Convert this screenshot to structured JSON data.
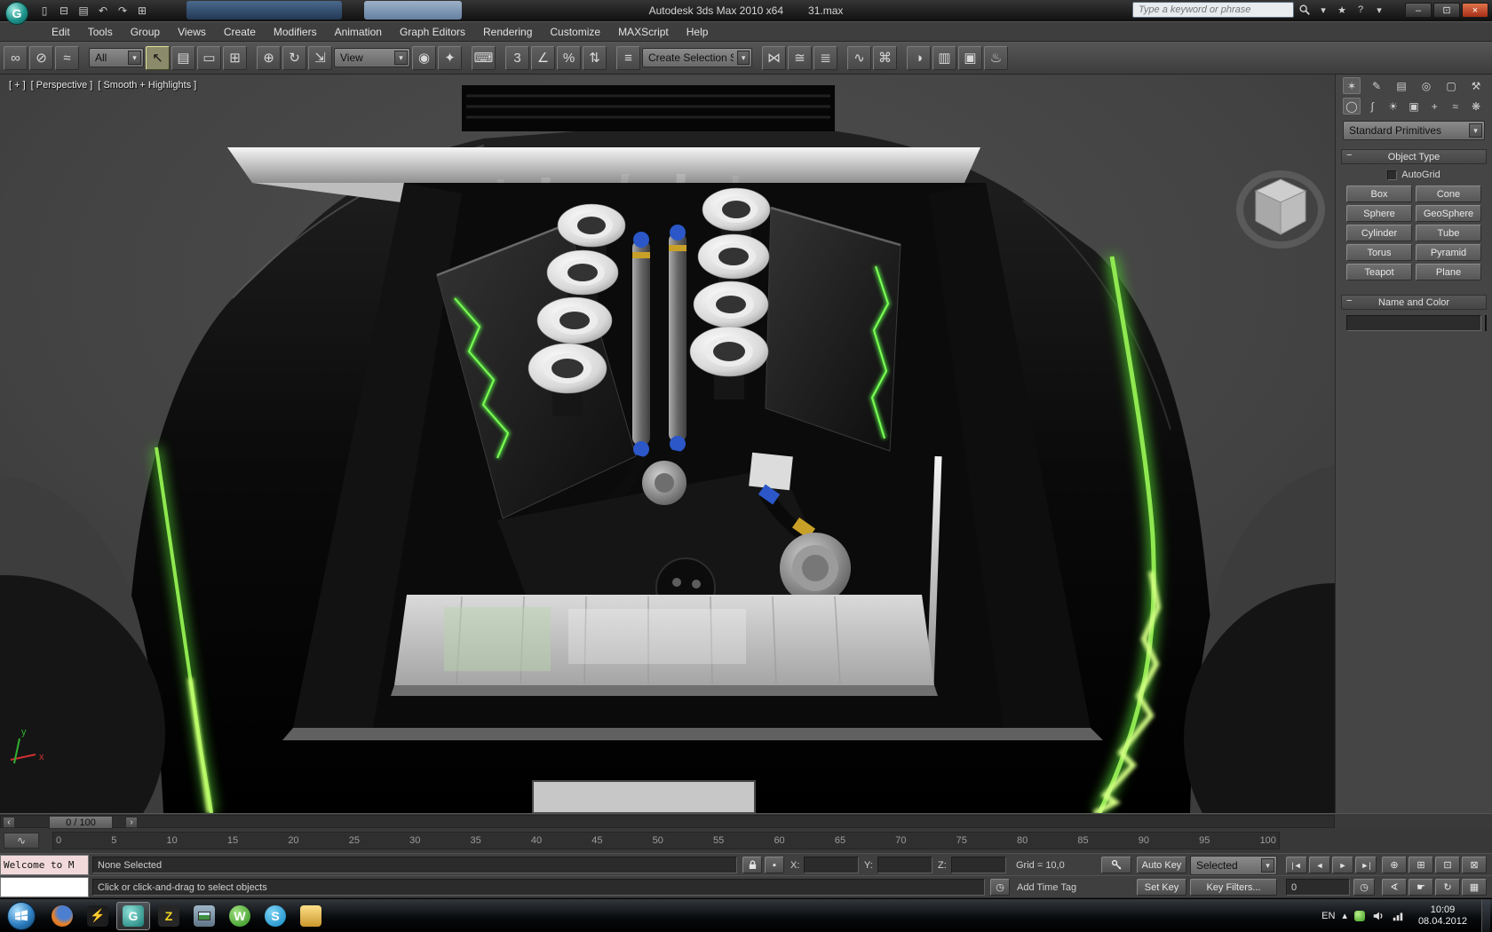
{
  "titlebar": {
    "app_title": "Autodesk 3ds Max 2010 x64",
    "document_name": "31.max",
    "search_placeholder": "Type a keyword or phrase"
  },
  "menubar": {
    "items": [
      "Edit",
      "Tools",
      "Group",
      "Views",
      "Create",
      "Modifiers",
      "Animation",
      "Graph Editors",
      "Rendering",
      "Customize",
      "MAXScript",
      "Help"
    ]
  },
  "toolbar": {
    "selection_filter_value": "All",
    "coordinate_system_value": "View",
    "named_selection_value": "Create Selection Se"
  },
  "viewport": {
    "label_general": "[ + ]",
    "label_pov": "[ Perspective ]",
    "label_shading": "[ Smooth + Highlights ]"
  },
  "command_panel": {
    "category_dropdown_value": "Standard Primitives",
    "object_type": {
      "title": "Object Type",
      "autogrid_label": "AutoGrid",
      "buttons": [
        "Box",
        "Cone",
        "Sphere",
        "GeoSphere",
        "Cylinder",
        "Tube",
        "Torus",
        "Pyramid",
        "Teapot",
        "Plane"
      ]
    },
    "name_color": {
      "title": "Name and Color",
      "name_value": "",
      "swatch_style": "background:#c01240"
    }
  },
  "timeline": {
    "slider_label": "0 / 100",
    "ticks": [
      "0",
      "5",
      "10",
      "15",
      "20",
      "25",
      "30",
      "35",
      "40",
      "45",
      "50",
      "55",
      "60",
      "65",
      "70",
      "75",
      "80",
      "85",
      "90",
      "95",
      "100"
    ]
  },
  "statusbar": {
    "macro_recorder_text": "Welcome to M",
    "selection_status": "None Selected",
    "prompt": "Click or click-and-drag to select objects",
    "x_label": "X:",
    "y_label": "Y:",
    "z_label": "Z:",
    "x_value": "",
    "y_value": "",
    "z_value": "",
    "grid_status": "Grid = 10,0",
    "add_time_tag": "Add Time Tag"
  },
  "animation": {
    "auto_key_label": "Auto Key",
    "set_key_label": "Set Key",
    "key_mode_value": "Selected",
    "key_filters_label": "Key Filters...",
    "current_frame": "0"
  },
  "taskbar": {
    "language": "EN",
    "clock_time": "10:09",
    "clock_date": "08.04.2012",
    "skype_letter": "S",
    "webmoney_letter": "W",
    "archiver_letter": "Z",
    "max_letter": "G"
  },
  "icons": {
    "app_logo": "G",
    "new_file": "▯",
    "open_file": "⊟",
    "save_file": "▤",
    "undo": "↶",
    "redo": "↷",
    "project_folder": "⊞",
    "favorites": "★",
    "help": "?",
    "dropdown": "▾",
    "minimize": "–",
    "restore": "⊡",
    "close": "×",
    "select_link": "∞",
    "unlink": "⊘",
    "bind_warp": "≈",
    "select_object": "↖",
    "select_by_name": "▤",
    "region": "▭",
    "window_crossing": "⊞",
    "move": "⊕",
    "rotate": "↻",
    "scale": "⇲",
    "pivot_center": "◉",
    "manipulate": "✦",
    "kbd_override": "⌨",
    "snap_3d": "3",
    "angle_snap": "∠",
    "percent_snap": "%",
    "spinner_snap": "⇅",
    "named_sets": "≡",
    "mirror": "⋈",
    "align": "≅",
    "layers": "≣",
    "curve_editor": "∿",
    "schematic_view": "⌘",
    "material_editor": "◑",
    "render_setup": "▥",
    "render_frame": "▣",
    "render": "♨",
    "tab_create": "✶",
    "tab_modify": "✎",
    "tab_hierarchy": "▤",
    "tab_motion": "◎",
    "tab_display": "▢",
    "tab_utilities": "⚒",
    "cat_geometry": "◯",
    "cat_shapes": "∫",
    "cat_lights": "☀",
    "cat_cameras": "▣",
    "cat_helpers": "+",
    "cat_spacewarps": "≈",
    "cat_systems": "❋",
    "rollout_collapse": "−",
    "slider_prev": "‹",
    "slider_next": "›",
    "mini_curve": "∿",
    "abs_offset": "▪",
    "time_tag": "◷",
    "goto_start": "|◄",
    "prev_frame": "◄",
    "play": "►",
    "goto_end": "►|",
    "time_config": "◷",
    "nav_zoom": "⊕",
    "nav_zoom_all": "⊞",
    "nav_extents": "⊡",
    "nav_extents_all": "⊠",
    "nav_fov": "∢",
    "nav_pan": "☛",
    "nav_orbit": "↻",
    "nav_maximize": "▦",
    "bolt": "⚡",
    "tray_arrow": "▴"
  }
}
